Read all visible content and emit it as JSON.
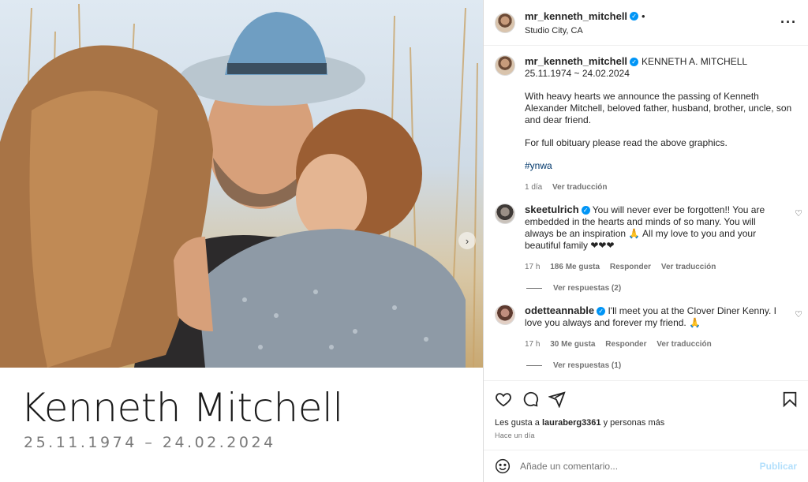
{
  "post": {
    "username": "mr_kenneth_mitchell",
    "header_separator": "•",
    "location": "Studio City, CA",
    "more_icon": "more-horizontal-icon"
  },
  "media": {
    "memorial_name": "Kenneth Mitchell",
    "memorial_dates": "25.11.1974 – 24.02.2024",
    "next_icon": "chevron-right-icon"
  },
  "caption": {
    "username": "mr_kenneth_mitchell",
    "full_name": "KENNETH A. MITCHELL",
    "dates": "25.11.1974 ~ 24.02.2024",
    "paragraph1": "With heavy hearts we announce the passing of Kenneth Alexander Mitchell, beloved father, husband, brother, uncle, son and dear friend.",
    "paragraph2": "For full obituary please read the above graphics.",
    "hashtag": "#ynwa",
    "time": "1 día",
    "translate": "Ver traducción"
  },
  "comments": [
    {
      "username": "skeetulrich",
      "text": "You will never ever be forgotten!! You are embedded in the hearts and minds of so many. You will always be an inspiration 🙏 All my love to you and your beautiful family ❤❤❤",
      "time": "17 h",
      "likes": "186 Me gusta",
      "reply": "Responder",
      "translate": "Ver traducción",
      "replies": "Ver respuestas (2)"
    },
    {
      "username": "odetteannable",
      "text": "I'll meet you at the Clover Diner Kenny. I love you always and forever my friend. 🙏",
      "time": "17 h",
      "likes": "30 Me gusta",
      "reply": "Responder",
      "translate": "Ver traducción",
      "replies": "Ver respuestas (1)"
    }
  ],
  "actions": {
    "likes_prefix": "Les gusta a",
    "likes_user": "lauraberg3361",
    "likes_suffix": "y personas más",
    "ago": "Hace un día",
    "icons": [
      "heart-icon",
      "comment-icon",
      "share-icon",
      "save-icon"
    ]
  },
  "composer": {
    "placeholder": "Añade un comentario...",
    "publish": "Publicar"
  },
  "colors": {
    "link": "#00376b",
    "verified": "#0095f6",
    "muted": "#737373",
    "publish_disabled": "#b2dffc"
  }
}
